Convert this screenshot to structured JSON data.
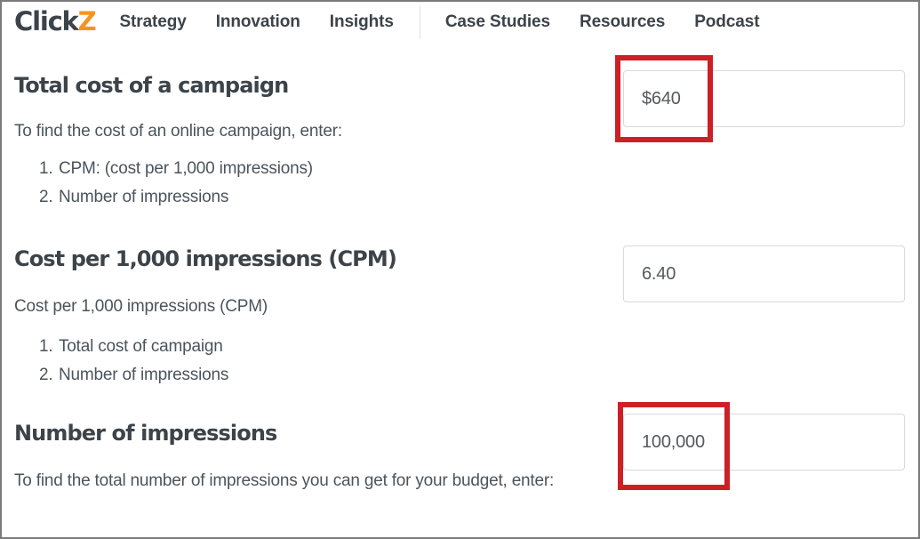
{
  "header": {
    "logo": {
      "main": "Click",
      "accent": "Z",
      "name": "ClickZ"
    },
    "nav_items": [
      {
        "label": "Strategy"
      },
      {
        "label": "Innovation"
      },
      {
        "label": "Insights"
      },
      {
        "label": "Case Studies"
      },
      {
        "label": "Resources"
      },
      {
        "label": "Podcast"
      }
    ]
  },
  "sections": [
    {
      "title": "Total cost of a campaign",
      "description": "To find the cost of an online campaign, enter:",
      "list": [
        {
          "marker": "1.",
          "text": "CPM: (cost per 1,000 impressions)"
        },
        {
          "marker": "2.",
          "text": "Number of impressions"
        }
      ],
      "field": {
        "value": "$640",
        "highlighted": true
      }
    },
    {
      "title": "Cost per 1,000 impressions (CPM)",
      "description": "Cost per 1,000 impressions (CPM)",
      "list": [
        {
          "marker": "1.",
          "text": "Total cost of campaign"
        },
        {
          "marker": "2.",
          "text": "Number of impressions"
        }
      ],
      "field": {
        "value": "6.40",
        "highlighted": false
      }
    },
    {
      "title": "Number of impressions",
      "description": "To find the total number of impressions you can get for your budget, enter:",
      "list": [],
      "field": {
        "value": "100,000",
        "highlighted": true
      }
    }
  ],
  "colors": {
    "logo_accent": "#f7941e",
    "heading": "#3c4349",
    "body_text": "#4b545c",
    "annotation_red": "#cd2026",
    "field_border": "#d9d9d9",
    "outer_border": "#7b7b7b"
  }
}
